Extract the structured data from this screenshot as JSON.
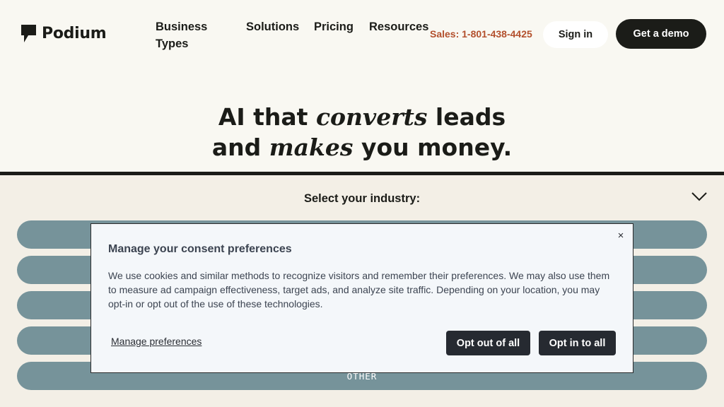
{
  "header": {
    "logo_text": "Podium",
    "nav": [
      "Business Types",
      "Solutions",
      "Pricing",
      "Resources"
    ],
    "sales": "Sales: 1-801-438-4425",
    "sign_in": "Sign in",
    "demo": "Get a demo"
  },
  "hero": {
    "line1_start": "AI that ",
    "line1_em": "converts",
    "line1_end": " leads",
    "line2_start": "and ",
    "line2_em": "makes",
    "line2_end": " you money."
  },
  "industry": {
    "label": "Select your industry:",
    "options": [
      "",
      "",
      "",
      "",
      "OTHER"
    ]
  },
  "consent": {
    "title": "Manage your consent preferences",
    "body": "We use cookies and similar methods to recognize visitors and remember their preferences. We may also use them to measure ad campaign effectiveness, target ads, and analyze site traffic. Depending on your location, you may opt-in or opt out of the use of these technologies.",
    "manage": "Manage preferences",
    "opt_out": "Opt out of all",
    "opt_in": "Opt in to all",
    "close": "×"
  },
  "colors": {
    "background": "#f9f8f2",
    "ink": "#1b1c18",
    "sales": "#b3502d",
    "pill": "#76939a",
    "modal_bg": "#f4f7fa",
    "modal_button": "#262a31"
  }
}
